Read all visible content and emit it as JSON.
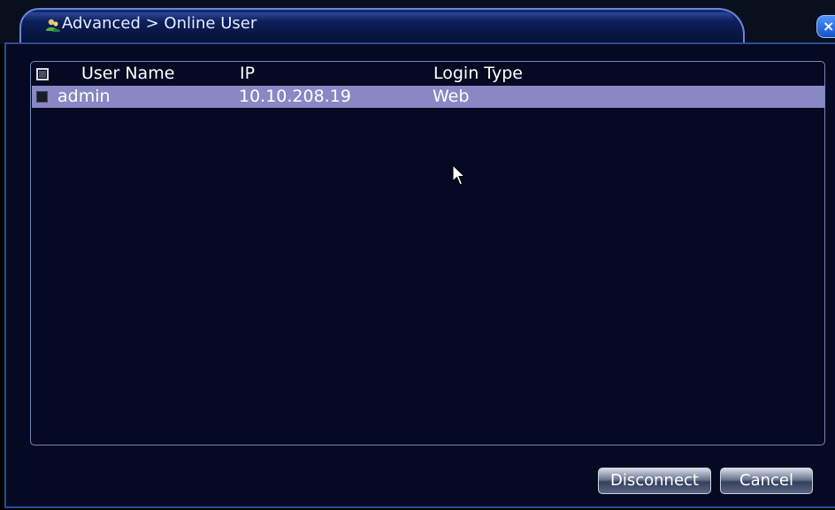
{
  "window": {
    "title": "Advanced > Online User",
    "close_label": "×"
  },
  "table": {
    "columns": [
      "User Name",
      "IP",
      "Login Type"
    ],
    "rows": [
      {
        "user_name": "admin",
        "ip": "10.10.208.19",
        "login_type": "Web",
        "selected": true
      }
    ]
  },
  "buttons": {
    "disconnect": "Disconnect",
    "cancel": "Cancel"
  },
  "colors": {
    "panel_bg": "#050a22",
    "selected_row": "#8888c4",
    "title_tab": "#0a1a4d",
    "close_button": "#1552c8"
  },
  "icons": {
    "title": "users-icon",
    "close": "close-icon",
    "pointer": "mouse-cursor-icon"
  }
}
